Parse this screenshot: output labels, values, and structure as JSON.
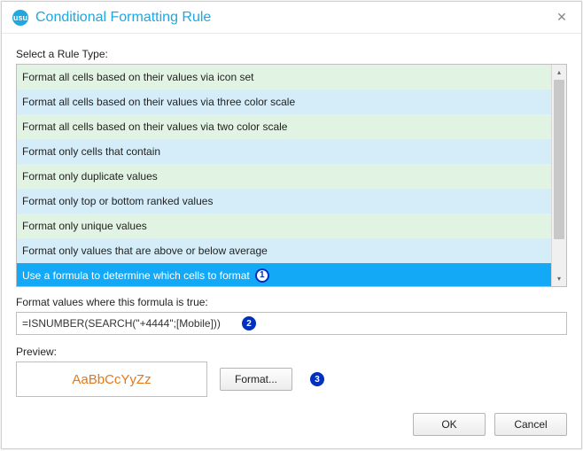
{
  "window": {
    "icon_text": "usu",
    "title": "Conditional Formatting Rule"
  },
  "labels": {
    "select_rule_type": "Select a Rule Type:",
    "formula_label": "Format values where this formula is true:",
    "preview_label": "Preview:"
  },
  "rule_types": {
    "items": [
      {
        "label": "Format all cells based on their values via icon set",
        "selected": false
      },
      {
        "label": "Format all cells based on their values via three color scale",
        "selected": false
      },
      {
        "label": "Format all cells based on their values via two color scale",
        "selected": false
      },
      {
        "label": "Format only cells that contain",
        "selected": false
      },
      {
        "label": "Format only duplicate values",
        "selected": false
      },
      {
        "label": "Format only top or bottom ranked values",
        "selected": false
      },
      {
        "label": "Format only unique values",
        "selected": false
      },
      {
        "label": "Format only values that are above or below average",
        "selected": false
      },
      {
        "label": "Use a formula to determine which cells to format",
        "selected": true
      }
    ]
  },
  "formula": {
    "value": "=ISNUMBER(SEARCH(\"+4444\";[Mobile]))"
  },
  "preview": {
    "sample_text": "AaBbCcYyZz",
    "color": "#e67817"
  },
  "buttons": {
    "format": "Format...",
    "ok": "OK",
    "cancel": "Cancel"
  },
  "annotations": {
    "b1": "1",
    "b2": "2",
    "b3": "3"
  },
  "scroll": {
    "up_glyph": "▴",
    "down_glyph": "▾"
  }
}
